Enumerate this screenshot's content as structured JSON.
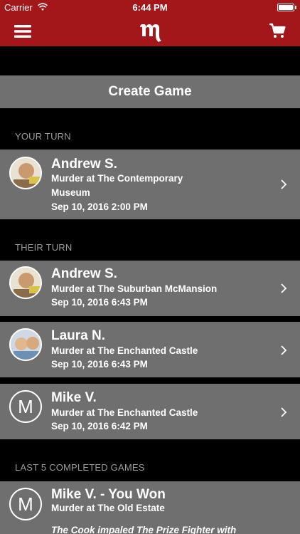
{
  "status": {
    "carrier": "Carrier",
    "time": "6:44 PM",
    "battery_level": 1.0
  },
  "nav": {
    "menu_icon": "hamburger-menu-icon",
    "logo_icon": "m-logo",
    "cart_icon": "shopping-cart-icon"
  },
  "create_game": {
    "label": "Create Game"
  },
  "sections": {
    "your_turn": "YOUR TURN",
    "their_turn": "THEIR TURN",
    "completed": "LAST 5 COMPLETED GAMES"
  },
  "your_turn_games": [
    {
      "name": "Andrew S.",
      "title_line1": "Murder at The Contemporary",
      "title_line2": "Museum",
      "date": "Sep 10, 2016 2:00 PM"
    }
  ],
  "their_turn_games": [
    {
      "name": "Andrew S.",
      "title": "Murder at The Suburban McMansion",
      "date": "Sep 10, 2016 6:43 PM"
    },
    {
      "name": "Laura N.",
      "title": "Murder at The Enchanted Castle",
      "date": "Sep 10, 2016 6:43 PM"
    },
    {
      "name": "Mike V.",
      "avatar_letter": "M",
      "title": "Murder at The Enchanted Castle",
      "date": "Sep 10, 2016 6:42 PM"
    }
  ],
  "completed_games": [
    {
      "name": "Mike V. - You Won",
      "avatar_letter": "M",
      "title": "Murder at The Old Estate",
      "description": "The Cook impaled The Prize Fighter with"
    }
  ],
  "colors": {
    "brand_red": "#a3161a",
    "row_gray": "#6f6f6f",
    "button_gray": "#707070",
    "section_text": "#9c9c9c"
  }
}
